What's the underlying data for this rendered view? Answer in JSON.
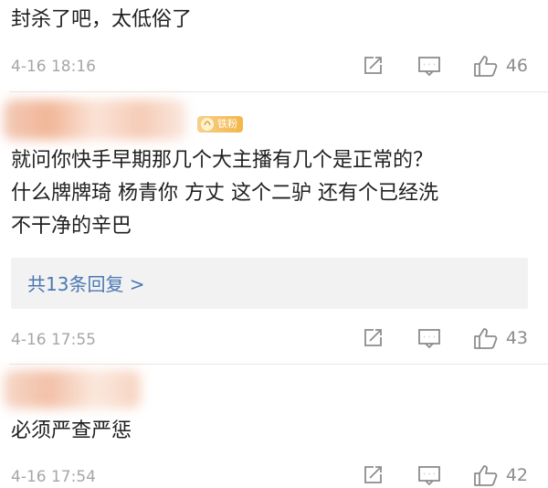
{
  "comments": [
    {
      "text": "封杀了吧，太低俗了",
      "timestamp": "4-16 18:16",
      "likes": "46"
    },
    {
      "badge": "铁粉",
      "text": "就问你快手早期那几个大主播有几个是正常的？\n什么牌牌琦 杨青你 方丈 这个二驴 还有个已经洗\n不干净的辛巴",
      "replies_label": "共13条回复 >",
      "timestamp": "4-16 17:55",
      "likes": "43"
    },
    {
      "text": "必须严查严惩",
      "timestamp": "4-16 17:54",
      "likes": "42"
    }
  ],
  "icons": {
    "repost": "repost-icon",
    "comment": "comment-icon",
    "like": "thumbs-up-icon"
  },
  "colors": {
    "link": "#4a78b2",
    "meta": "#a6a6a6",
    "reply_box_bg": "#f2f2f2",
    "badge": "#f3b64a"
  }
}
